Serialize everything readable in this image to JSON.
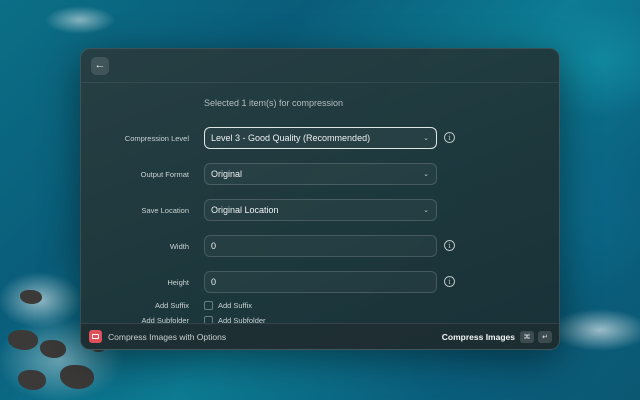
{
  "header": {
    "back_icon": "arrow-left-icon"
  },
  "selection_text": "Selected 1 item(s) for compression",
  "form": {
    "compression_level": {
      "label": "Compression Level",
      "value": "Level 3 - Good Quality (Recommended)"
    },
    "output_format": {
      "label": "Output Format",
      "value": "Original"
    },
    "save_location": {
      "label": "Save Location",
      "value": "Original Location"
    },
    "width": {
      "label": "Width",
      "value": "0"
    },
    "height": {
      "label": "Height",
      "value": "0"
    },
    "add_suffix": {
      "label": "Add Suffix",
      "checkbox_label": "Add Suffix",
      "checked": false
    },
    "add_subfolder": {
      "label": "Add Subfolder",
      "checkbox_label": "Add Subfolder",
      "checked": false
    }
  },
  "footer": {
    "title": "Compress Images with Options",
    "action": "Compress Images",
    "shortcut": [
      "⌘",
      "↵"
    ],
    "icon_color": "#e0505a"
  }
}
